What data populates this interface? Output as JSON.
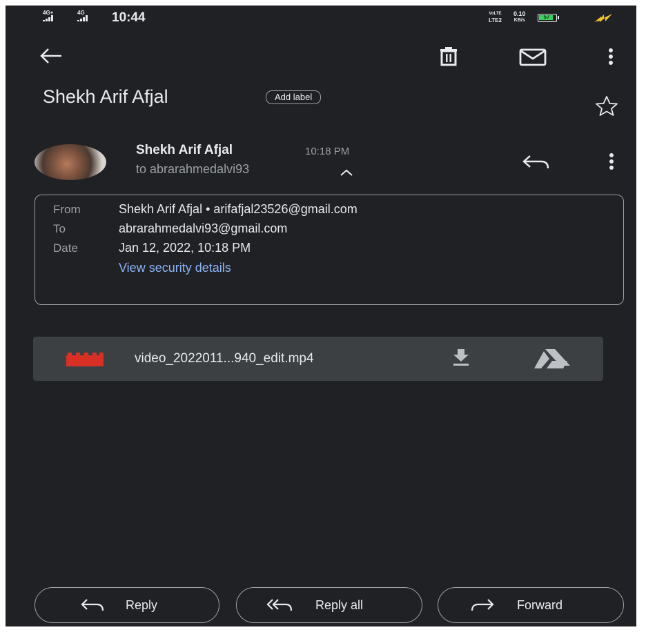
{
  "status_bar": {
    "network1": "4G+",
    "network2": "4G",
    "time": "10:44",
    "volte_top": "VoLTE",
    "volte_bottom": "LTE2",
    "speed_value": "0.10",
    "speed_unit": "KB/s",
    "battery": "57",
    "battery_level": 0.57
  },
  "toolbar": {
    "back": "back-arrow-icon",
    "delete": "trash-icon",
    "mark_unread": "mail-icon",
    "more": "more-vert-icon"
  },
  "message": {
    "subject": "Shekh Arif Afjal",
    "label_chip": "Add label",
    "sender_name": "Shekh Arif Afjal",
    "time": "10:18 PM",
    "to_line": "to abrarahmedalvi93"
  },
  "details": {
    "from_label": "From",
    "from_value": "Shekh Arif Afjal • arifafjal23526@gmail.com",
    "to_label": "To",
    "to_value": "abrarahmedalvi93@gmail.com",
    "date_label": "Date",
    "date_value": "Jan 12, 2022, 10:18 PM",
    "security_link": "View security details"
  },
  "attachment": {
    "filename": "video_2022011...940_edit.mp4",
    "icon_color": "#d93025"
  },
  "actions": {
    "reply": "Reply",
    "reply_all": "Reply all",
    "forward": "Forward"
  },
  "colors": {
    "background": "#202124",
    "link": "#8ab4f8",
    "attachment_bg": "#3c4043"
  }
}
